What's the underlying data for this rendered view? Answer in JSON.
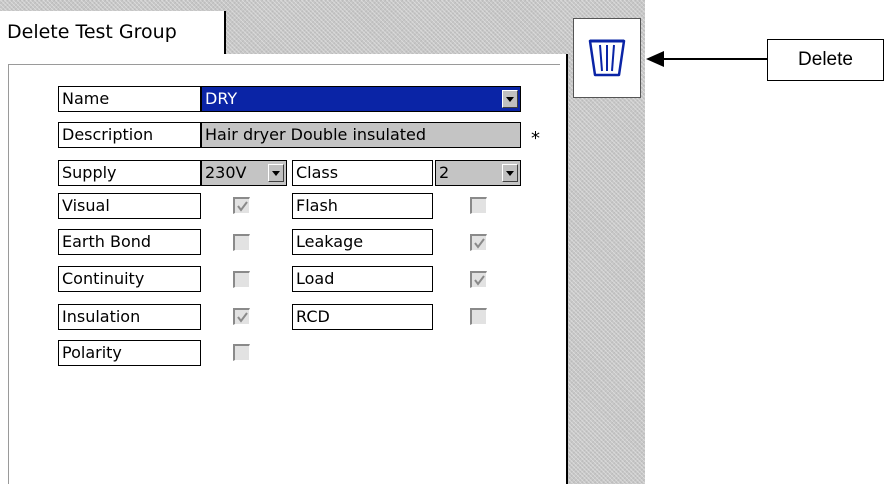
{
  "tab": {
    "title": "Delete Test Group"
  },
  "delete_icon": "trash-icon",
  "fields": {
    "name": {
      "label": "Name",
      "value": "DRY"
    },
    "description": {
      "label": "Description",
      "value": "Hair dryer Double insulated",
      "marker": "*"
    },
    "supply": {
      "label": "Supply",
      "value": "230V"
    },
    "class": {
      "label": "Class",
      "value": "2"
    }
  },
  "tests_left": [
    {
      "label": "Visual",
      "checked": true
    },
    {
      "label": "Earth Bond",
      "checked": false
    },
    {
      "label": "Continuity",
      "checked": false
    },
    {
      "label": "Insulation",
      "checked": true
    },
    {
      "label": "Polarity",
      "checked": false
    }
  ],
  "tests_right": [
    {
      "label": "Flash",
      "checked": false
    },
    {
      "label": "Leakage",
      "checked": true
    },
    {
      "label": "Load",
      "checked": true
    },
    {
      "label": "RCD",
      "checked": false
    }
  ],
  "callout": {
    "label": "Delete"
  },
  "colors": {
    "selected": "#0a24a6",
    "background": "#c7c7c7"
  }
}
